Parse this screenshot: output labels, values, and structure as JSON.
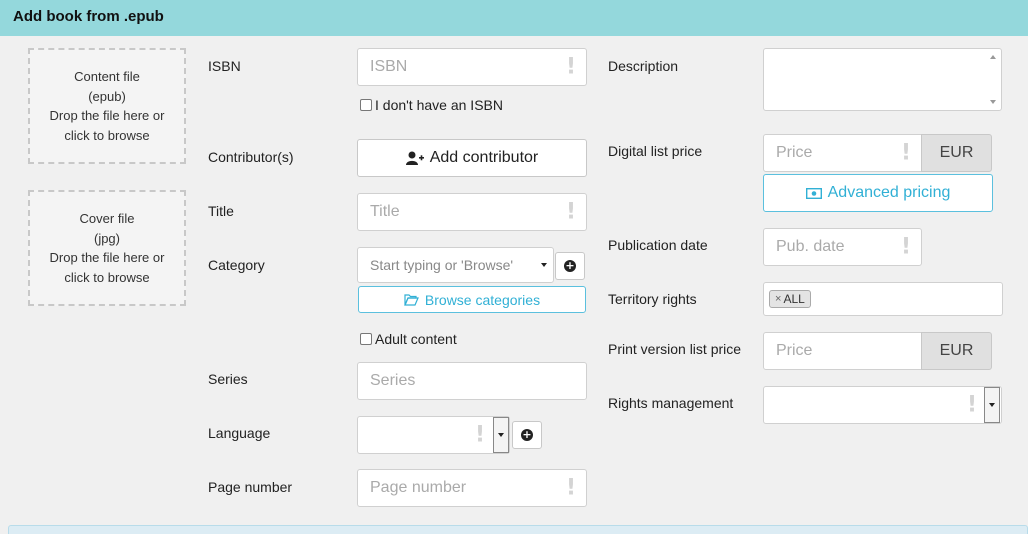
{
  "header": {
    "title": "Add book from .epub"
  },
  "content_drop": {
    "line1": "Content file",
    "line2": "(epub)",
    "line3": "Drop the file here or",
    "line4": "click to browse"
  },
  "cover_drop": {
    "line1": "Cover file",
    "line2": "(jpg)",
    "line3": "Drop the file here or",
    "line4": "click to browse"
  },
  "isbn": {
    "label": "ISBN",
    "placeholder": "ISBN",
    "no_isbn_label": "I don't have an ISBN"
  },
  "contributors": {
    "label": "Contributor(s)",
    "button": "Add contributor"
  },
  "title": {
    "label": "Title",
    "placeholder": "Title"
  },
  "category": {
    "label": "Category",
    "placeholder": "Start typing or 'Browse'",
    "browse_button": "Browse categories",
    "adult_label": "Adult content"
  },
  "series": {
    "label": "Series",
    "placeholder": "Series"
  },
  "language": {
    "label": "Language",
    "value": ""
  },
  "page_number": {
    "label": "Page number",
    "placeholder": "Page number"
  },
  "description": {
    "label": "Description",
    "value": ""
  },
  "digital_price": {
    "label": "Digital list price",
    "placeholder": "Price",
    "currency": "EUR",
    "advanced_button": "Advanced pricing"
  },
  "publication_date": {
    "label": "Publication date",
    "placeholder": "Pub. date"
  },
  "territory": {
    "label": "Territory rights",
    "tags": [
      "ALL"
    ]
  },
  "print_price": {
    "label": "Print version list price",
    "placeholder": "Price",
    "currency": "EUR"
  },
  "rights": {
    "label": "Rights management",
    "value": ""
  },
  "colors": {
    "header": "#94d8dc",
    "accent": "#31b0d5",
    "background": "#f0f0f0"
  },
  "icons": {
    "required": "exclamation-icon",
    "add_contributor": "user-plus-icon",
    "browse": "folder-open-icon",
    "advanced": "money-icon",
    "add": "plus-circle-icon",
    "dropdown": "caret-down-icon"
  }
}
